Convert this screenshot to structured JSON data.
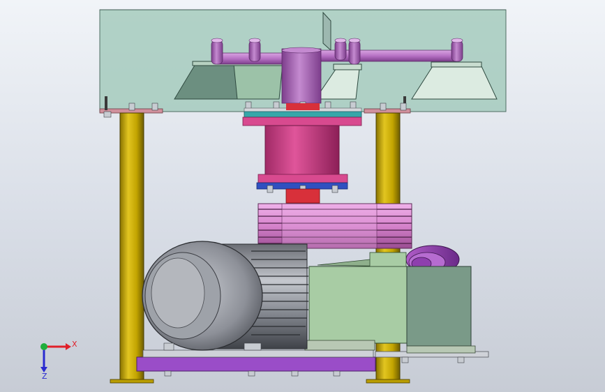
{
  "triad": {
    "x_label": "X",
    "z_label": "Z",
    "x_color": "#e0202a",
    "y_color": "#1fae3c",
    "z_color": "#2a2ad0"
  },
  "colors": {
    "enclosure_fill": "#a9cfc2",
    "enclosure_edge": "#5d7a70",
    "pipe": "#bb7ac8",
    "column": "#c7a800",
    "bearing_housing": "#d84a8f",
    "flange_teal": "#3aa8a8",
    "flange_blue": "#3050c0",
    "shaft_red": "#d8303a",
    "pulley": "#d88ad0",
    "motor": "#9a9ea6",
    "gearbox": "#a8cca4",
    "gear_guard": "#7a9a88",
    "base_frame": "#9a4dc8",
    "hood": "#cfe1d7"
  }
}
